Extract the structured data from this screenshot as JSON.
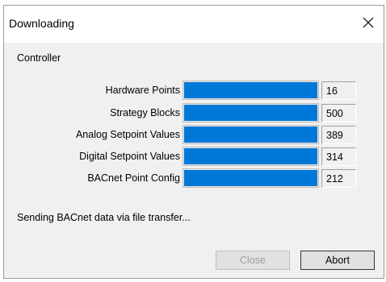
{
  "window": {
    "title": "Downloading",
    "close_icon": "close-icon"
  },
  "section_label": "Controller",
  "progress_rows": [
    {
      "label": "Hardware Points",
      "count": "16",
      "progress_fraction": 1.0
    },
    {
      "label": "Strategy Blocks",
      "count": "500",
      "progress_fraction": 1.0
    },
    {
      "label": "Analog Setpoint Values",
      "count": "389",
      "progress_fraction": 1.0
    },
    {
      "label": "Digital Setpoint Values",
      "count": "314",
      "progress_fraction": 1.0
    },
    {
      "label": "BACnet Point Config",
      "count": "212",
      "progress_fraction": 1.0
    }
  ],
  "status_text": "Sending BACnet data via file transfer...",
  "buttons": {
    "close_label": "Close",
    "close_enabled": false,
    "abort_label": "Abort"
  },
  "colors": {
    "progress_fill": "#0078d7",
    "dialog_background": "#f0f0f0"
  }
}
